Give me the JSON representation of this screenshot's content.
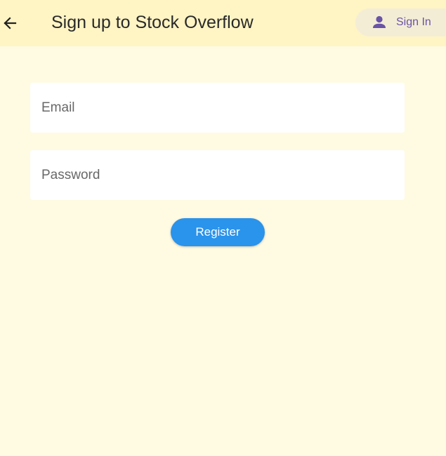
{
  "appbar": {
    "back_icon": "arrow-left-icon",
    "title": "Sign up to Stock Overflow",
    "signin": {
      "icon": "person-icon",
      "label": "Sign In"
    }
  },
  "form": {
    "email": {
      "placeholder": "Email",
      "value": ""
    },
    "password": {
      "placeholder": "Password",
      "value": ""
    },
    "register_label": "Register"
  },
  "colors": {
    "background": "#fffbe3",
    "appbar": "#fff4c4",
    "signin_background": "#f4edd6",
    "signin_text": "#6a54a6",
    "primary_button": "#2a93ec"
  }
}
